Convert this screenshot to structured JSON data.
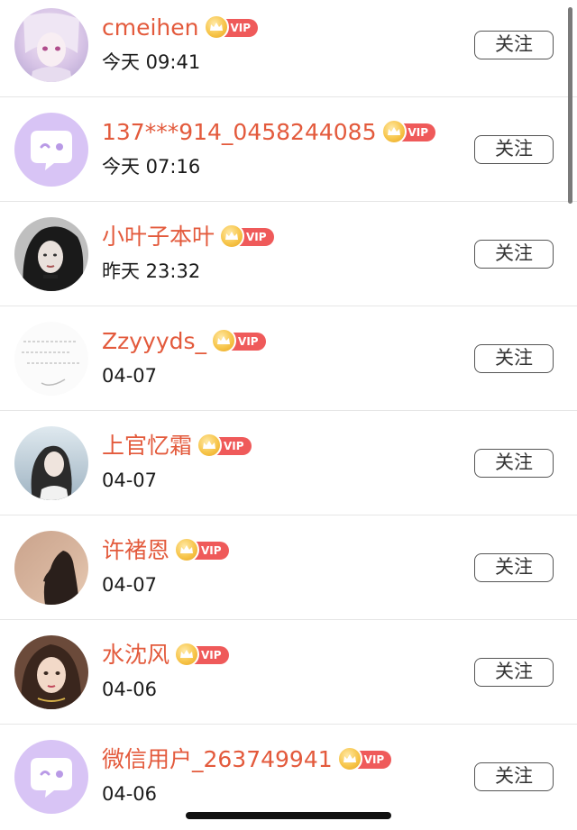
{
  "follow_label": "关注",
  "vip_label": "VIP",
  "colors": {
    "name": "#e35a3c",
    "vip_badge": "#ef5a5a",
    "crown": "#f7c54a",
    "default_avatar": "#d8c4f5"
  },
  "users": [
    {
      "name": "cmeihen",
      "time": "今天 09:41",
      "avatar": "anime-girl-photo"
    },
    {
      "name": "137***914_0458244085",
      "time": "今天 07:16",
      "avatar": "default-chat-avatar"
    },
    {
      "name": "小叶子本叶",
      "time": "昨天 23:32",
      "avatar": "woman-dark-hair-photo"
    },
    {
      "name": "Zzyyyds_",
      "time": "04-07",
      "avatar": "handwriting-photo"
    },
    {
      "name": "上官忆霜",
      "time": "04-07",
      "avatar": "woman-sky-photo"
    },
    {
      "name": "许褚恩",
      "time": "04-07",
      "avatar": "silhouette-sunset-photo"
    },
    {
      "name": "水沈风",
      "time": "04-06",
      "avatar": "woman-portrait-photo"
    },
    {
      "name": "微信用户_263749941",
      "time": "04-06",
      "avatar": "default-chat-avatar"
    }
  ]
}
